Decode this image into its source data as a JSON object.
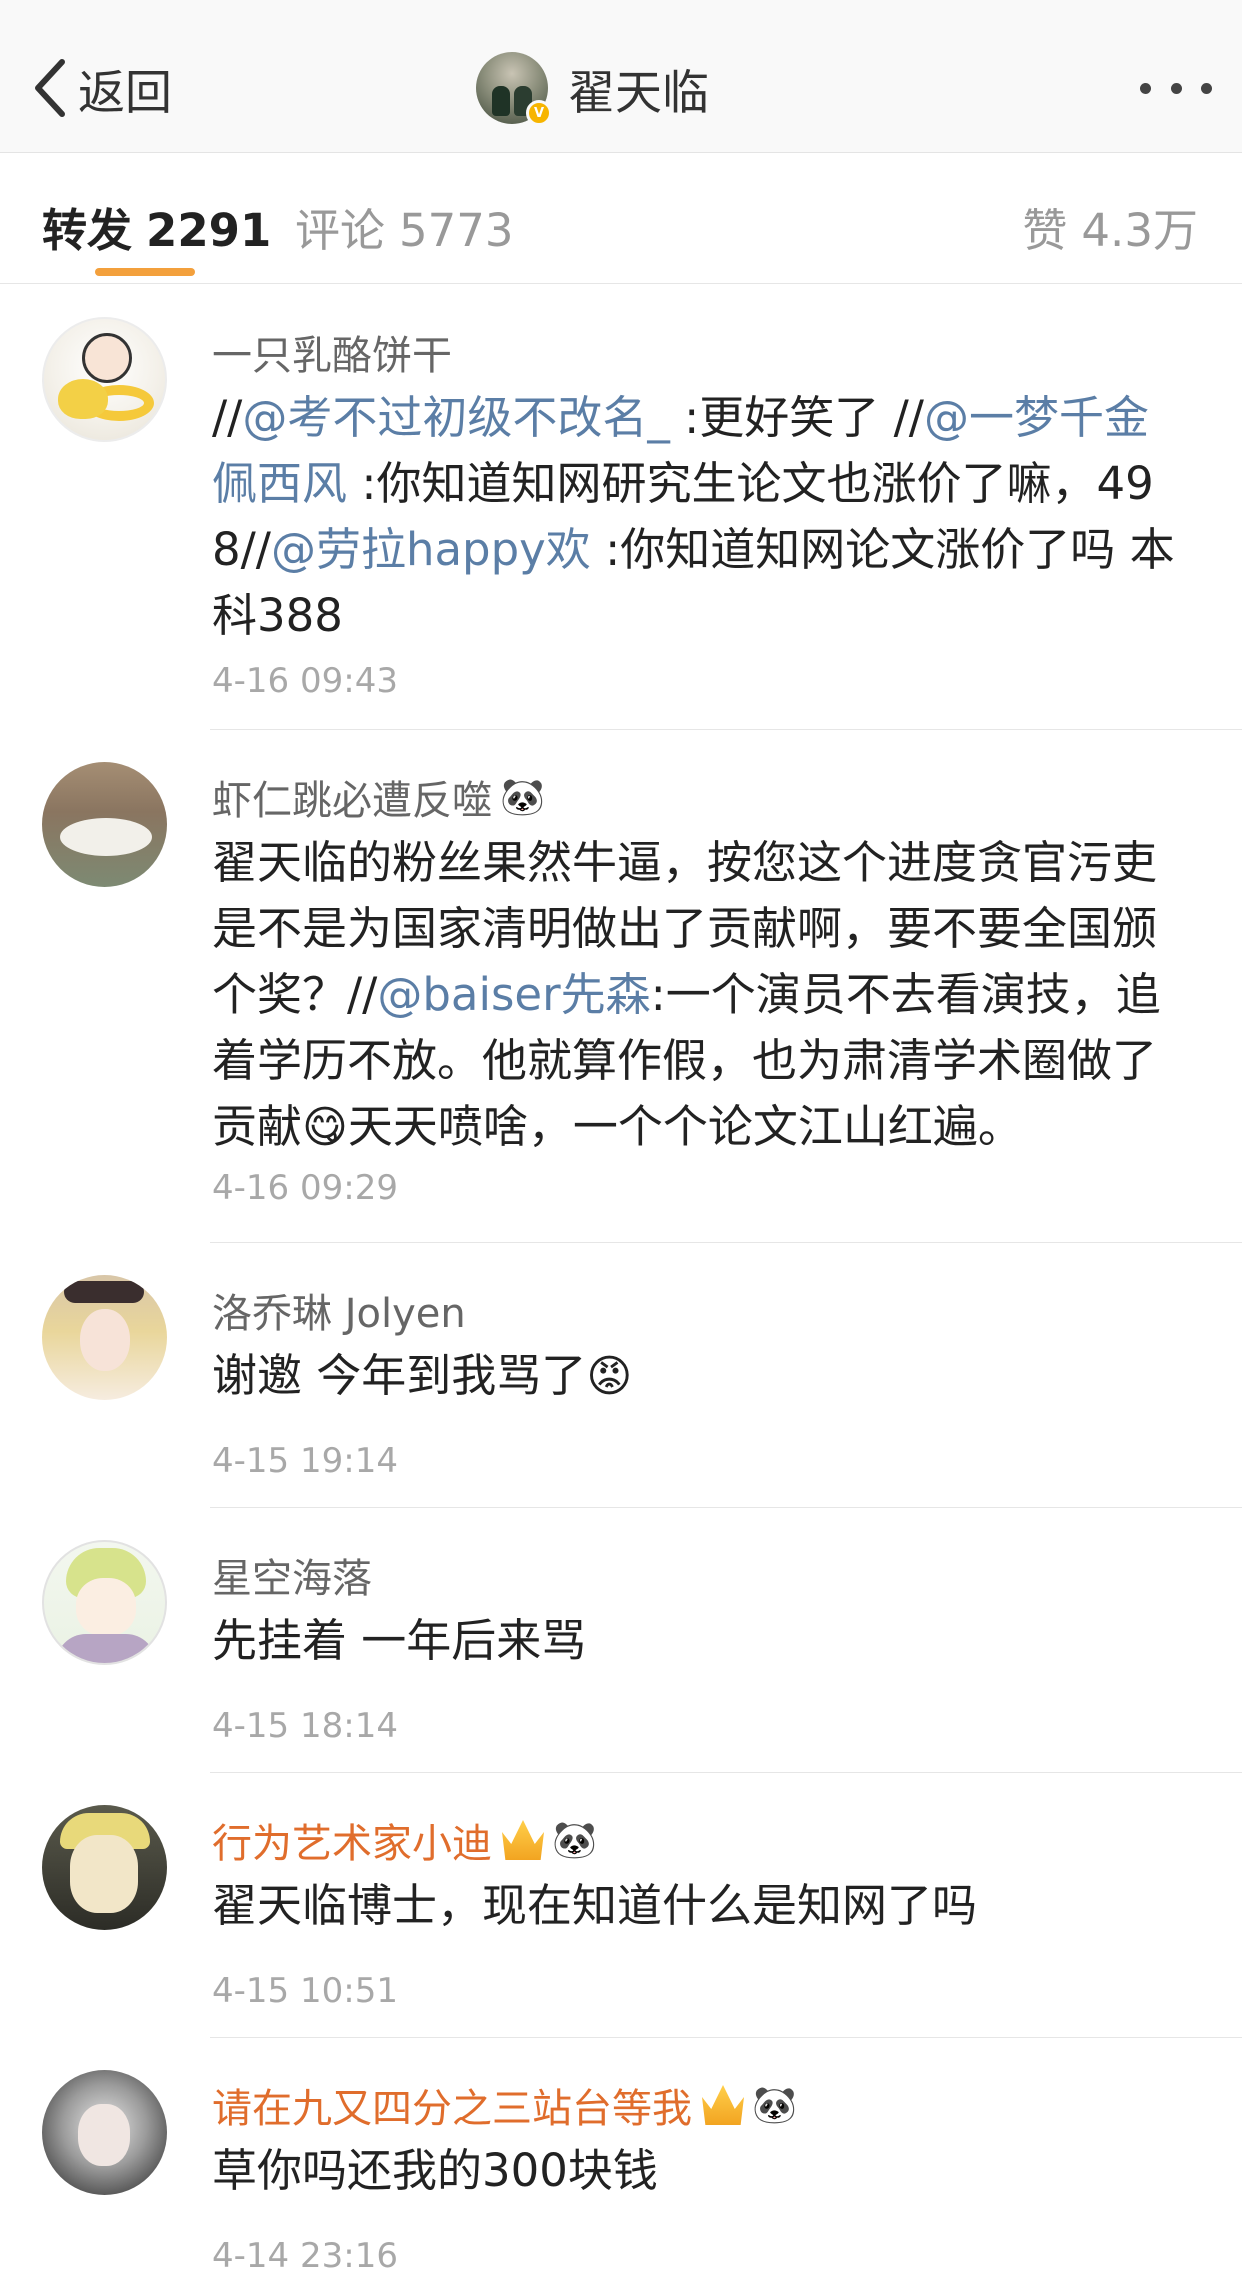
{
  "nav": {
    "back_label": "返回",
    "title": "翟天临",
    "verified_badge": "V"
  },
  "tabs": {
    "forward_label": "转发",
    "forward_count": "2291",
    "comment_label": "评论",
    "comment_count": "5773",
    "like_label": "赞",
    "like_count": "4.3万"
  },
  "colors": {
    "accent_underline": "#f3a03c",
    "mention": "#5b7ea6",
    "vip_name": "#e06d2c"
  },
  "items": [
    {
      "username": "一只乳酪饼干",
      "time": "4-16 09:43",
      "parts": [
        {
          "t": "//"
        },
        {
          "m": "@考不过初级不改名_"
        },
        {
          "t": " :更好笑了 //"
        },
        {
          "m": "@一梦千金佩西风"
        },
        {
          "t": " :你知道知网研究生论文也涨价了嘛，498//"
        },
        {
          "m": "@劳拉happy欢"
        },
        {
          "t": " :你知道知网论文涨价了吗 本科388"
        }
      ]
    },
    {
      "username": "虾仁跳必遭反噬",
      "username_badge": "🐼",
      "time": "4-16 09:29",
      "parts": [
        {
          "t": "翟天临的粉丝果然牛逼，按您这个进度贪官污吏是不是为国家清明做出了贡献啊，要不要全国颁个奖？//"
        },
        {
          "m": "@baiser先森"
        },
        {
          "t": ":一个演员不去看演技，追着学历不放。他就算作假，也为肃清学术圈做了贡献"
        },
        {
          "e": "😋"
        },
        {
          "t": "天天喷啥，一个个论文江山红遍。"
        }
      ]
    },
    {
      "username": "洛乔琳 Jolyen",
      "time": "4-15 19:14",
      "parts": [
        {
          "t": "谢邀 今年到我骂了"
        },
        {
          "e": "😡"
        }
      ]
    },
    {
      "username": "星空海落",
      "time": "4-15 18:14",
      "parts": [
        {
          "t": "先挂着 一年后来骂"
        }
      ]
    },
    {
      "username": "行为艺术家小迪",
      "username_badge": "🐼",
      "vip": true,
      "time": "4-15 10:51",
      "parts": [
        {
          "t": "翟天临博士，现在知道什么是知网了吗"
        }
      ]
    },
    {
      "username": "请在九又四分之三站台等我",
      "username_badge": "🐼",
      "vip": true,
      "time": "4-14 23:16",
      "parts": [
        {
          "t": "草你吗还我的300块钱"
        }
      ]
    }
  ]
}
